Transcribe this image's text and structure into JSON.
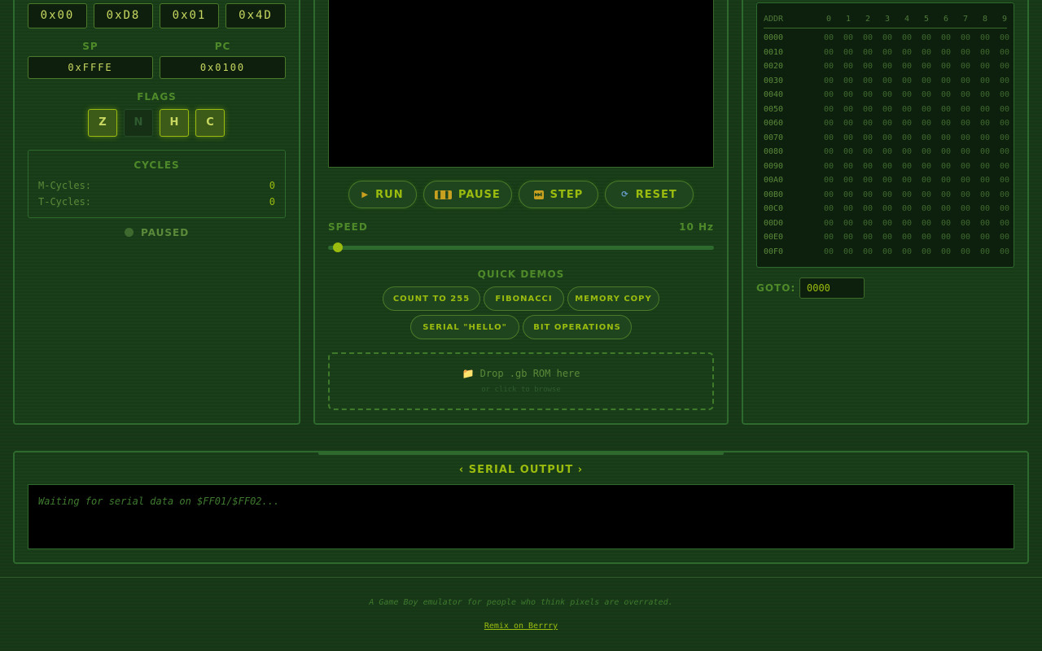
{
  "registers": {
    "top": [
      "0x00",
      "0xD8",
      "0x01",
      "0x4D"
    ],
    "sp_label": "SP",
    "sp_value": "0xFFFE",
    "pc_label": "PC",
    "pc_value": "0x0100"
  },
  "flags": {
    "title": "FLAGS",
    "items": [
      {
        "label": "Z",
        "on": true
      },
      {
        "label": "N",
        "on": false
      },
      {
        "label": "H",
        "on": true
      },
      {
        "label": "C",
        "on": true
      }
    ]
  },
  "cycles": {
    "title": "CYCLES",
    "m_label": "M-Cycles:",
    "m_value": "0",
    "t_label": "T-Cycles:",
    "t_value": "0"
  },
  "status": {
    "text": "PAUSED",
    "color": "#3f6a2f"
  },
  "controls": {
    "run": "RUN",
    "pause": "PAUSE",
    "step": "STEP",
    "reset": "RESET"
  },
  "speed": {
    "label": "SPEED",
    "value": "10 Hz",
    "fraction": 0.025
  },
  "demos": {
    "title": "QUICK DEMOS",
    "items": [
      "COUNT TO 255",
      "FIBONACCI",
      "MEMORY COPY",
      "SERIAL \"HELLO\"",
      "BIT OPERATIONS"
    ]
  },
  "rom": {
    "text": "Drop .gb ROM here",
    "sub": "or click to browse"
  },
  "memory": {
    "addr_header": "ADDR",
    "cols": [
      "0",
      "1",
      "2",
      "3",
      "4",
      "5",
      "6",
      "7",
      "8",
      "9"
    ],
    "rows": [
      "0000",
      "0010",
      "0020",
      "0030",
      "0040",
      "0050",
      "0060",
      "0070",
      "0080",
      "0090",
      "00A0",
      "00B0",
      "00C0",
      "00D0",
      "00E0",
      "00F0"
    ],
    "cell": "00"
  },
  "goto": {
    "label": "GOTO:",
    "value": "0000"
  },
  "serial": {
    "title": "‹ SERIAL OUTPUT ›",
    "placeholder": "Waiting for serial data on $FF01/$FF02..."
  },
  "footer": {
    "tagline": "A Game Boy emulator for people who think pixels are overrated.",
    "link": "Remix on Berrry"
  },
  "colors": {
    "accent": "#9bbc0f",
    "bg": "#163616"
  }
}
